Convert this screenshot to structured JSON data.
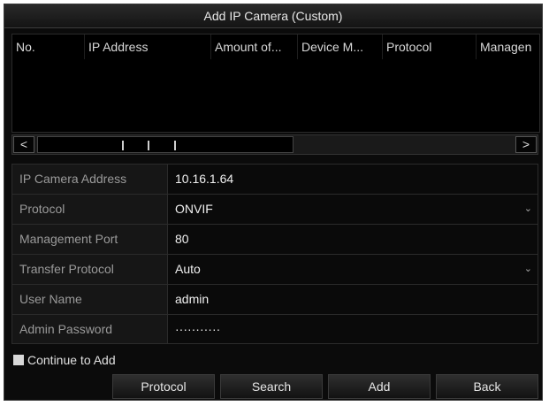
{
  "window": {
    "title": "Add IP Camera (Custom)"
  },
  "list": {
    "columns": [
      "No.",
      "IP Address",
      "Amount of...",
      "Device M...",
      "Protocol",
      "Managen"
    ]
  },
  "scrollbar": {
    "left_glyph": "<",
    "right_glyph": ">"
  },
  "form": {
    "ip_address": {
      "label": "IP Camera Address",
      "value": "10.16.1.64"
    },
    "protocol": {
      "label": "Protocol",
      "value": "ONVIF"
    },
    "management_port": {
      "label": "Management Port",
      "value": "80"
    },
    "transfer_protocol": {
      "label": "Transfer Protocol",
      "value": "Auto"
    },
    "user_name": {
      "label": "User Name",
      "value": "admin"
    },
    "admin_password": {
      "label": "Admin Password",
      "value": "···········"
    }
  },
  "continue_to_add": {
    "label": "Continue to Add",
    "checked": false
  },
  "buttons": {
    "protocol": "Protocol",
    "search": "Search",
    "add": "Add",
    "back": "Back"
  },
  "colors": {
    "background": "#0b0b0b",
    "label_bg": "#161616",
    "text": "#f0f0f0",
    "label_text": "#9a9a9a"
  },
  "icons": {
    "dropdown": "chevron-down-icon",
    "scroll_left": "chevron-left-icon",
    "scroll_right": "chevron-right-icon"
  }
}
